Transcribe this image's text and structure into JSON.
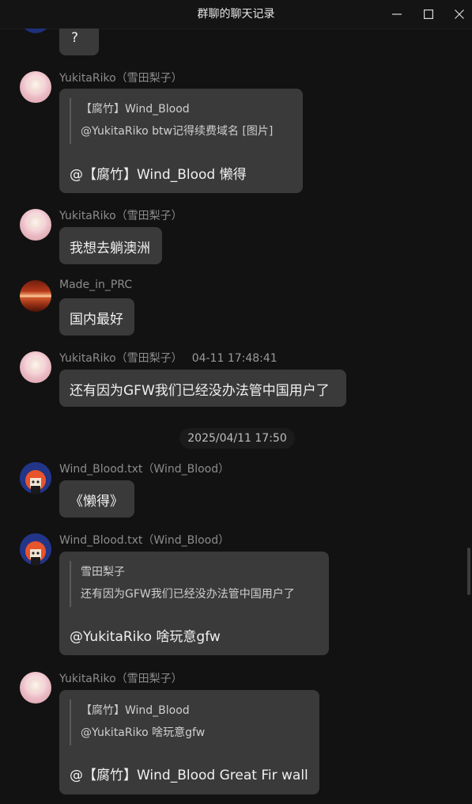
{
  "window": {
    "title": "群聊的聊天记录",
    "controls": [
      "minimize-icon",
      "maximize-icon",
      "close-icon"
    ]
  },
  "messages": [
    {
      "bubble_text": "?"
    },
    {
      "sender": "YukitaRiko（雪田梨子）",
      "quote": {
        "author": "【腐竹】Wind_Blood",
        "text": "@YukitaRiko btw记得续费域名 [图片]"
      },
      "text": "@【腐竹】Wind_Blood 懒得"
    },
    {
      "sender": "YukitaRiko（雪田梨子）",
      "text": "我想去躺澳洲"
    },
    {
      "sender": "Made_in_PRC",
      "text": "国内最好"
    },
    {
      "sender": "YukitaRiko（雪田梨子）",
      "time": "04-11 17:48:41",
      "text": "还有因为GFW我们已经没办法管中国用户了"
    },
    {
      "date_divider": "2025/04/11 17:50"
    },
    {
      "sender": "Wind_Blood.txt（Wind_Blood）",
      "text": "《懒得》"
    },
    {
      "sender": "Wind_Blood.txt（Wind_Blood）",
      "quote": {
        "author": "雪田梨子",
        "text": "还有因为GFW我们已经没办法管中国用户了"
      },
      "text": "@YukitaRiko 啥玩意gfw"
    },
    {
      "sender": "YukitaRiko（雪田梨子）",
      "quote": {
        "author": "【腐竹】Wind_Blood",
        "text": "@YukitaRiko 啥玩意gfw"
      },
      "text": "@【腐竹】Wind_Blood Great Fir wall"
    }
  ]
}
